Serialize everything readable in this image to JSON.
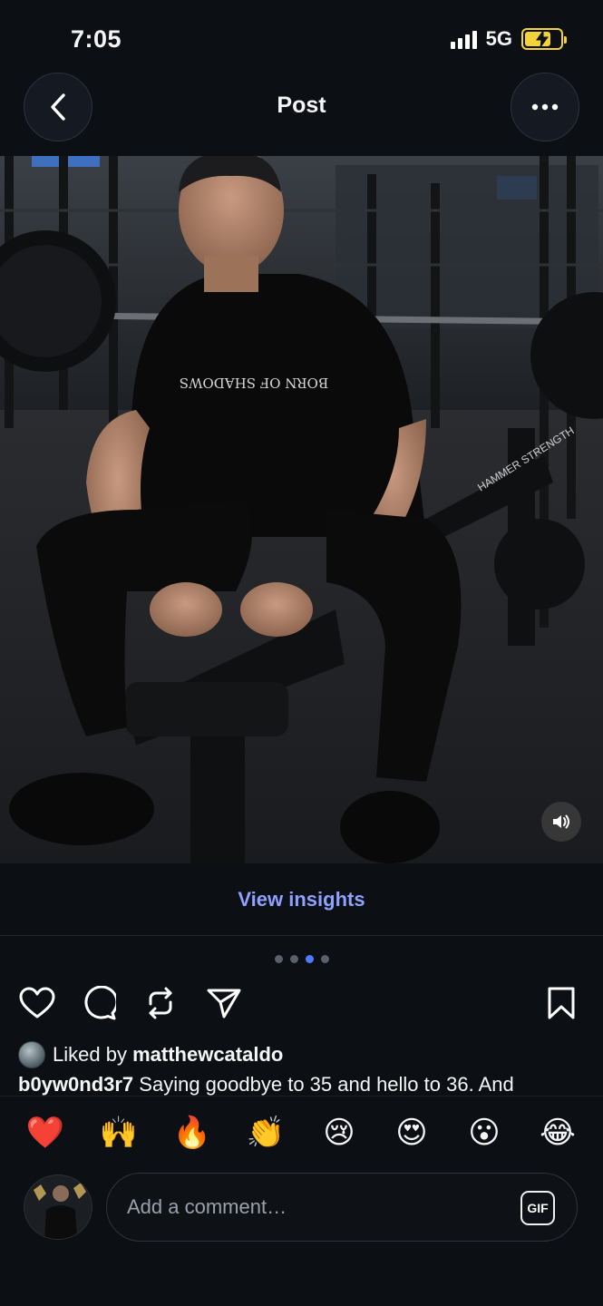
{
  "status": {
    "time": "7:05",
    "network": "5G"
  },
  "nav": {
    "title": "Post",
    "back_icon": "chevron-left-icon",
    "more_icon": "ellipsis-icon"
  },
  "media": {
    "sound_icon": "speaker-icon",
    "shirt_text": "BORN OF SHADOWS",
    "bench_text": "HAMMER STRENGTH"
  },
  "insights": {
    "label": "View insights"
  },
  "carousel": {
    "total": 4,
    "active_index": 2
  },
  "actions": {
    "like_icon": "heart-icon",
    "comment_icon": "comment-icon",
    "repost_icon": "repost-icon",
    "share_icon": "send-icon",
    "save_icon": "bookmark-icon"
  },
  "likes": {
    "prefix": "Liked by",
    "user": "matthewcataldo"
  },
  "caption": {
    "user": "b0yw0nd3r7",
    "text": "Saying goodbye to 35 and hello to 36. And"
  },
  "quick_reactions": [
    "❤️",
    "🙌",
    "🔥",
    "👏",
    "😢",
    "😍",
    "😮",
    "😂"
  ],
  "comment": {
    "placeholder": "Add a comment…",
    "gif_label": "GIF"
  },
  "colors": {
    "background": "#0c0f14",
    "link": "#8fa0ff",
    "active_dot": "#4d7dff",
    "battery": "#f4d23a"
  }
}
